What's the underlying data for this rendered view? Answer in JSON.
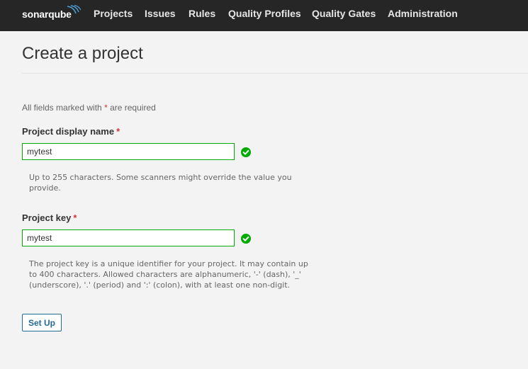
{
  "brand": {
    "name": "sonarqube"
  },
  "nav": {
    "items": [
      {
        "label": "Projects"
      },
      {
        "label": "Issues"
      },
      {
        "label": "Rules"
      },
      {
        "label": "Quality Profiles"
      },
      {
        "label": "Quality Gates"
      },
      {
        "label": "Administration"
      }
    ]
  },
  "page": {
    "title": "Create a project",
    "required_note_prefix": "All fields marked with",
    "required_star": "*",
    "required_note_suffix": "are required"
  },
  "form": {
    "display_name": {
      "label": "Project display name",
      "value": "mytest",
      "valid_icon": "check-circle-icon",
      "help": "Up to 255 characters. Some scanners might override the value you provide."
    },
    "project_key": {
      "label": "Project key",
      "value": "mytest",
      "valid_icon": "check-circle-icon",
      "help": "The project key is a unique identifier for your project. It may contain up to 400 characters. Allowed characters are alphanumeric, '-' (dash), '_' (underscore), '.' (period) and ':' (colon), with at least one non-digit."
    },
    "submit_label": "Set Up"
  },
  "colors": {
    "navbar_bg": "#262626",
    "valid_green": "#00aa00",
    "required_red": "#d4333f",
    "button_blue": "#236a97"
  }
}
